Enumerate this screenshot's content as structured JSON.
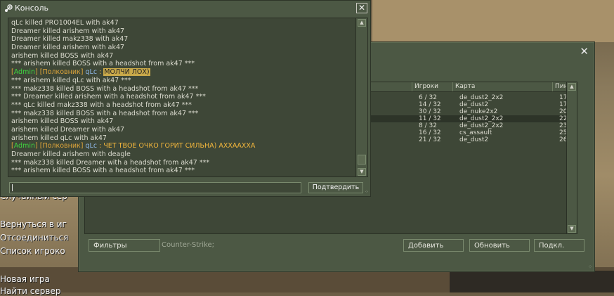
{
  "main_menu": {
    "items": [
      "Случайный сер",
      "Вернуться в иг",
      "Отсоединиться",
      "Список игроко",
      "Новая игра",
      "Найти сервер"
    ]
  },
  "server_browser": {
    "close_icon": "close-icon",
    "columns": [
      "Игроки",
      "Карта",
      "Пинг"
    ],
    "rows": [
      {
        "players": "6 / 32",
        "map": "de_dust2_2x2",
        "ping": "17"
      },
      {
        "players": "14 / 32",
        "map": "de_dust2",
        "ping": "17"
      },
      {
        "players": "30 / 32",
        "map": "de_nuke2x2",
        "ping": "20"
      },
      {
        "players": "11 / 32",
        "map": "de_dust2_2x2",
        "ping": "22",
        "selected": true
      },
      {
        "players": "8 / 32",
        "map": "de_dust2_2x2",
        "ping": "23"
      },
      {
        "players": "16 / 32",
        "map": "cs_assault",
        "ping": "25"
      },
      {
        "players": "21 / 32",
        "map": "de_dust2",
        "ping": "26"
      }
    ],
    "filters_label": "Фильтры",
    "filter_text": "Counter-Strike;",
    "add_label": "Добавить",
    "refresh_label": "Обновить",
    "connect_label": "Подкл."
  },
  "console": {
    "title": "Консоль",
    "icon": "steam-icon",
    "submit_label": "Подтвердить",
    "input_value": "",
    "lines": [
      {
        "type": "plain",
        "text": "qLc killed PRO1004EL with ak47"
      },
      {
        "type": "plain",
        "text": "Dreamer killed arishem with ak47"
      },
      {
        "type": "plain",
        "text": "Dreamer killed makz338 with ak47"
      },
      {
        "type": "plain",
        "text": "Dreamer killed arishem with ak47"
      },
      {
        "type": "plain",
        "text": "arishem killed BOSS with ak47"
      },
      {
        "type": "plain",
        "text": "*** arishem killed BOSS with a headshot from ak47 ***"
      },
      {
        "type": "chat",
        "admin": "Admin",
        "rank": "Полковник",
        "name": "qLc",
        "sep": " : ",
        "message": "МОЛЧИ ЛОХ)",
        "highlight": true
      },
      {
        "type": "plain",
        "text": "*** arishem killed qLc with ak47 ***"
      },
      {
        "type": "plain",
        "text": "*** makz338 killed BOSS with a headshot from ak47 ***"
      },
      {
        "type": "plain",
        "text": "*** Dreamer killed arishem with a headshot from ak47 ***"
      },
      {
        "type": "plain",
        "text": "*** qLc killed makz338 with a headshot from ak47 ***"
      },
      {
        "type": "plain",
        "text": "*** makz338 killed BOSS with a headshot from ak47 ***"
      },
      {
        "type": "plain",
        "text": "arishem killed BOSS with ak47"
      },
      {
        "type": "plain",
        "text": "arishem killed Dreamer with ak47"
      },
      {
        "type": "plain",
        "text": "arishem killed qLc with ak47"
      },
      {
        "type": "chat",
        "admin": "Admin",
        "rank": "Полковник",
        "name": "qLc",
        "sep": " : ",
        "message": "ЧЕТ ТВОЕ ОЧКО ГОРИТ СИЛЬНА) АХХААХХА",
        "highlight": false
      },
      {
        "type": "plain",
        "text": "Dreamer killed arishem with deagle"
      },
      {
        "type": "plain",
        "text": "*** makz338 killed Dreamer with a headshot from ak47 ***"
      },
      {
        "type": "plain",
        "text": "*** arishem killed BOSS with a headshot from ak47 ***"
      }
    ]
  }
}
